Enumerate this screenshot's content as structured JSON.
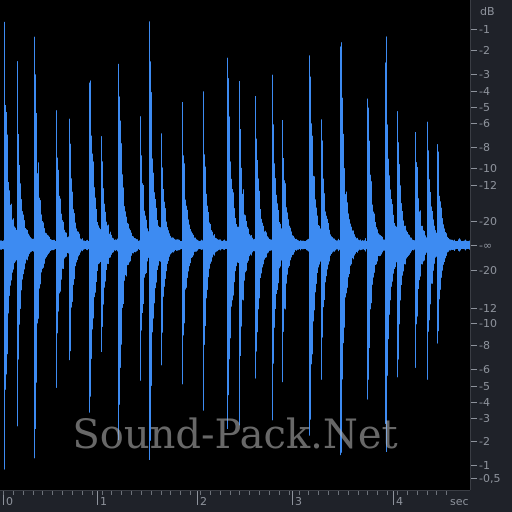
{
  "colors": {
    "waveform": "#3d8bf2",
    "background": "#000000",
    "ruler_bg": "#1f2229",
    "ruler_text": "#8e939c"
  },
  "waveform": {
    "duration_sec": 4.6,
    "hits": [
      {
        "t": 0.01,
        "amp": 1.0
      },
      {
        "t": 0.14,
        "amp": 0.78
      },
      {
        "t": 0.32,
        "amp": 0.88
      },
      {
        "t": 0.54,
        "amp": 0.62
      },
      {
        "t": 0.68,
        "amp": 0.48
      },
      {
        "t": 0.88,
        "amp": 1.0
      },
      {
        "t": 1.0,
        "amp": 0.55
      },
      {
        "t": 1.18,
        "amp": 0.98
      },
      {
        "t": 1.4,
        "amp": 0.62
      },
      {
        "t": 1.5,
        "amp": 0.92
      },
      {
        "t": 1.62,
        "amp": 0.48
      },
      {
        "t": 1.83,
        "amp": 0.65
      },
      {
        "t": 2.05,
        "amp": 0.62
      },
      {
        "t": 2.3,
        "amp": 0.98
      },
      {
        "t": 2.42,
        "amp": 0.68
      },
      {
        "t": 2.58,
        "amp": 0.74
      },
      {
        "t": 2.76,
        "amp": 0.7
      },
      {
        "t": 2.86,
        "amp": 0.58
      },
      {
        "t": 3.14,
        "amp": 1.0
      },
      {
        "t": 3.26,
        "amp": 0.55
      },
      {
        "t": 3.46,
        "amp": 1.0
      },
      {
        "t": 3.73,
        "amp": 0.84
      },
      {
        "t": 3.92,
        "amp": 1.0
      },
      {
        "t": 4.04,
        "amp": 0.65
      },
      {
        "t": 4.22,
        "amp": 0.62
      },
      {
        "t": 4.35,
        "amp": 0.55
      },
      {
        "t": 4.45,
        "amp": 0.48
      }
    ]
  },
  "db_ruler": {
    "unit": "dB",
    "labels": [
      "-1",
      "-2",
      "-3",
      "-4",
      "-5",
      "-6",
      "-8",
      "-10",
      "-12",
      "-20",
      "-∞",
      "-20",
      "-12",
      "-10",
      "-8",
      "-6",
      "-5",
      "-4",
      "-3",
      "-2",
      "-1",
      "-0,5"
    ]
  },
  "time_ruler": {
    "unit": "sec",
    "labels": [
      "0",
      "1",
      "2",
      "3",
      "4"
    ]
  },
  "watermark": "Sound-Pack.Net"
}
